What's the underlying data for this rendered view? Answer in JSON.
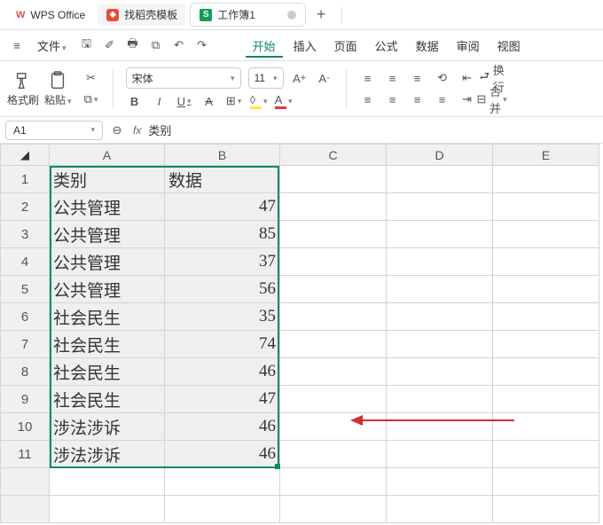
{
  "titleBar": {
    "appName": "WPS Office",
    "templateTab": "找稻壳模板",
    "docTab": "工作簿1",
    "docIcon": "S"
  },
  "menuBar": {
    "fileLabel": "文件",
    "items": [
      "开始",
      "插入",
      "页面",
      "公式",
      "数据",
      "审阅",
      "视图"
    ]
  },
  "toolbar": {
    "formatBrush": "格式刷",
    "paste": "粘贴",
    "font": "宋体",
    "fontSize": "11",
    "wrap": "换行",
    "merge": "合并"
  },
  "formulaBar": {
    "nameBox": "A1",
    "fx": "fx",
    "value": "类别"
  },
  "sheet": {
    "columns": [
      "A",
      "B",
      "C",
      "D",
      "E"
    ],
    "rows": [
      {
        "n": "1",
        "a": "类别",
        "b": "数据"
      },
      {
        "n": "2",
        "a": "公共管理",
        "b": "47"
      },
      {
        "n": "3",
        "a": "公共管理",
        "b": "85"
      },
      {
        "n": "4",
        "a": "公共管理",
        "b": "37"
      },
      {
        "n": "5",
        "a": "公共管理",
        "b": "56"
      },
      {
        "n": "6",
        "a": "社会民生",
        "b": "35"
      },
      {
        "n": "7",
        "a": "社会民生",
        "b": "74"
      },
      {
        "n": "8",
        "a": "社会民生",
        "b": "46"
      },
      {
        "n": "9",
        "a": "社会民生",
        "b": "47"
      },
      {
        "n": "10",
        "a": "涉法涉诉",
        "b": "46"
      },
      {
        "n": "11",
        "a": "涉法涉诉",
        "b": "46"
      }
    ]
  }
}
